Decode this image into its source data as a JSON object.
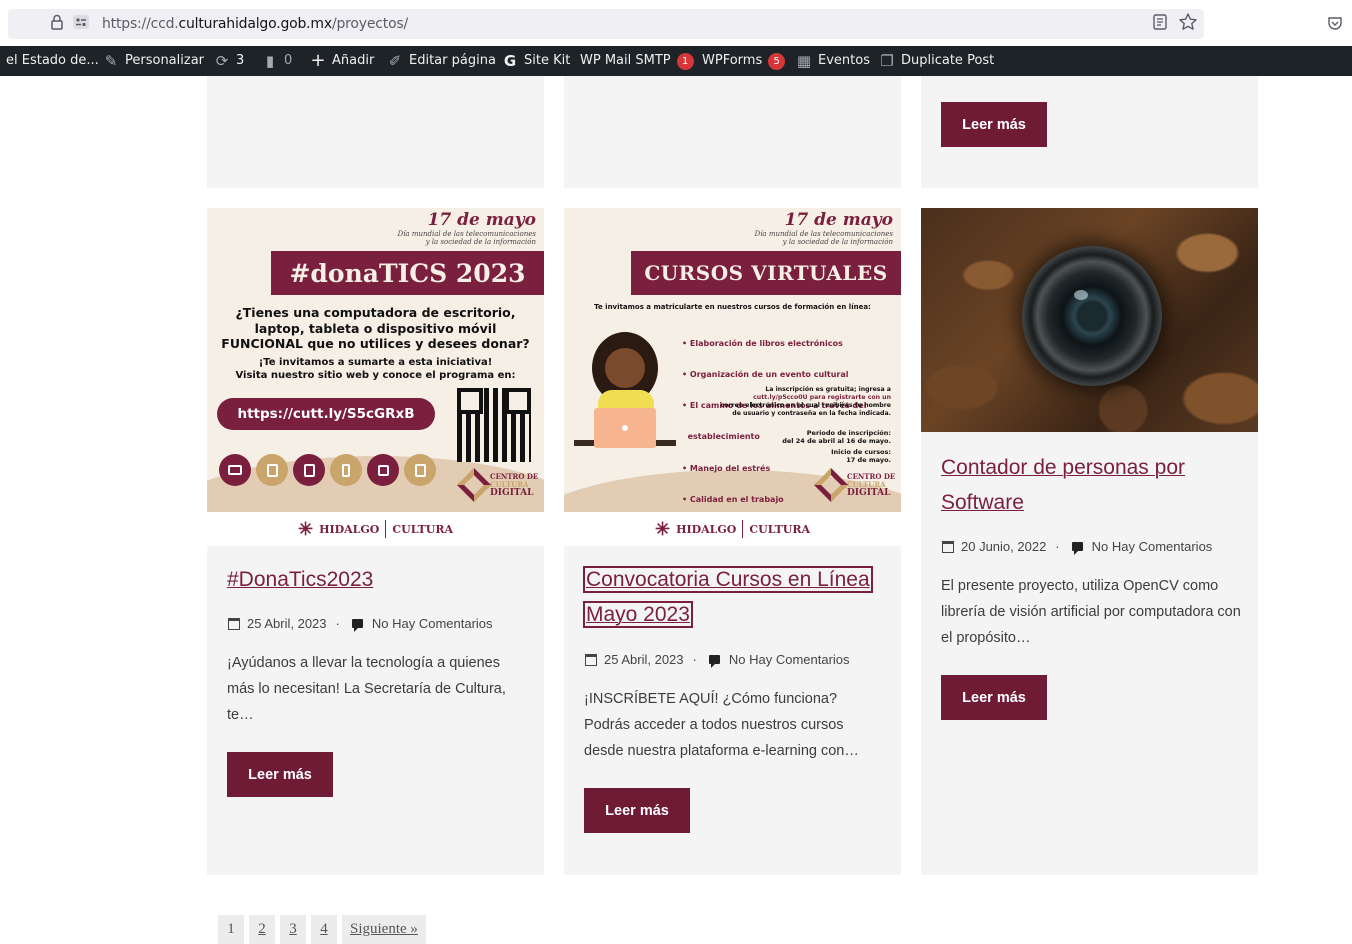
{
  "browser": {
    "url_prefix": "https://ccd.",
    "url_domain": "culturahidalgo.gob.mx",
    "url_path": "/proyectos/",
    "icons": [
      "shield-icon",
      "lock-icon",
      "permissions-icon",
      "reader-view-icon",
      "bookmark-star-icon",
      "pocket-icon"
    ]
  },
  "adminbar": {
    "site_name": "el Estado de...",
    "customize": "Personalizar",
    "updates_count": "3",
    "comments_count": "0",
    "add_new": "Añadir",
    "edit_page": "Editar página",
    "site_kit": "Site Kit",
    "wp_mail_smtp": "WP Mail SMTP",
    "wp_mail_smtp_badge": "1",
    "wpforms": "WPForms",
    "wpforms_badge": "5",
    "events": "Eventos",
    "duplicate_post": "Duplicate Post"
  },
  "top_row": {
    "read_more": "Leer más"
  },
  "posts": [
    {
      "title": "#DonaTics2023",
      "date": "25 Abril, 2023",
      "comments": "No Hay Comentarios",
      "excerpt": "¡Ayúdanos a llevar la tecnología a quienes más lo necesitan! La Secretaría de Cultura, te…",
      "read_more": "Leer más",
      "poster": {
        "date": "17 de mayo",
        "subtitle_1": "Día mundial de las telecomunicaciones",
        "subtitle_2": "y la sociedad de la información",
        "banner": "#donaTICS 2023",
        "line1": "¿Tienes una computadora de escritorio,",
        "line2": "laptop, tableta o dispositivo móvil",
        "line3_bold": "FUNCIONAL",
        "line3_rest": " que no utilices y desees donar?",
        "line4": "¡Te invitamos a sumarte a esta iniciativa!",
        "line5": "Visita nuestro sitio web y conoce el programa en:",
        "link": "https://cutt.ly/S5cGRxB",
        "logo_1": "CENTRO DE",
        "logo_2": "CULTURA",
        "logo_3": "DIGITAL",
        "footer_left": "HIDALGO",
        "footer_right": "CULTURA"
      }
    },
    {
      "title_line1": "Convocatoria Cursos en Línea",
      "title_line2": "Mayo 2023",
      "date": "25 Abril, 2023",
      "comments": "No Hay Comentarios",
      "excerpt": "¡INSCRÍBETE AQUÍ! ¿Cómo funciona? Podrás acceder a todos nuestros cursos desde nuestra plataforma e-learning con…",
      "read_more": "Leer más",
      "poster": {
        "date": "17 de mayo",
        "subtitle_1": "Día mundial de las telecomunicaciones",
        "subtitle_2": "y la sociedad de la información",
        "banner": "CURSOS VIRTUALES",
        "intro": "Te invitamos a matricularte en nuestros cursos de formación en línea:",
        "courses": [
          "• Elaboración de libros electrónicos",
          "• Organización de un evento cultural",
          "• El camino de los alimentos a través del",
          "  establecimiento",
          "• Manejo del estrés",
          "• Calidad en el trabajo"
        ],
        "signup_1": "La inscripción es gratuita; ingresa a",
        "signup_2": "cutt.ly/p5cco0U para registrarte con un",
        "signup_3": "correo electrónico en el cual recibirás tu nombre",
        "signup_4": "de usuario y contraseña en la fecha indicada.",
        "period_label": "Periodo de inscripción:",
        "period_value": "del 24 de abril al 16 de mayo.",
        "start_label": "Inicio de cursos:",
        "start_value": "17 de mayo.",
        "logo_1": "CENTRO DE",
        "logo_2": "CULTURA",
        "logo_3": "DIGITAL",
        "footer_left": "HIDALGO",
        "footer_right": "CULTURA"
      }
    },
    {
      "title_line1": "Contador de personas por",
      "title_line2": "Software",
      "date": "20 Junio, 2022",
      "comments": "No Hay Comentarios",
      "excerpt": "El presente proyecto, utiliza OpenCV como librería de visión artificial por computadora con el propósito…",
      "read_more": "Leer más"
    }
  ],
  "pagination": {
    "current": "1",
    "pages": [
      "2",
      "3",
      "4"
    ],
    "next": "Siguiente »"
  }
}
